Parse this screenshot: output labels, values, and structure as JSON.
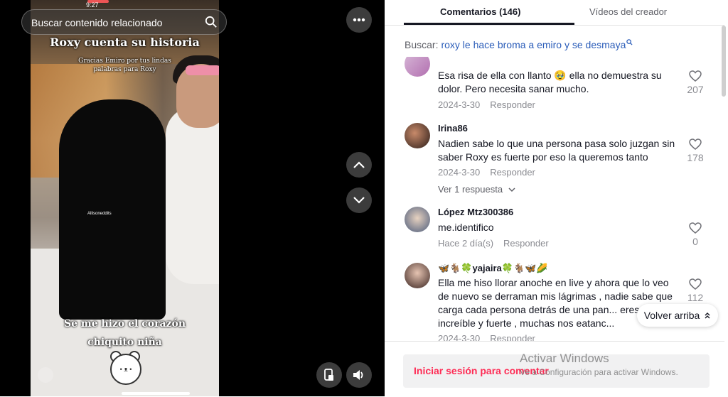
{
  "video": {
    "status_time": "9:27",
    "search_label": "Buscar contenido relacionado",
    "caption_title": "Roxy cuenta su historia",
    "caption_sub": "Gracias Emiro por tus lindas palabras para Roxy",
    "caption_bottom": "Se me hizo el corazón chiquito niña",
    "watermark": "Allisoneddits"
  },
  "tabs": {
    "comments": "Comentarios (146)",
    "creator_videos": "Vídeos del creador"
  },
  "search": {
    "prefix": "Buscar:",
    "query": "roxy le hace broma a emiro y se desmaya"
  },
  "comments": [
    {
      "name": "",
      "text": "Esa risa de ella con llanto 🥹 ella no demuestra su dolor. Pero necesita sanar mucho.",
      "date": "2024-3-30",
      "reply": "Responder",
      "likes": "207"
    },
    {
      "name": "Irina86",
      "text": "Nadien sabe lo que una persona pasa solo juzgan sin saber Roxy es fuerte por eso la queremos tanto",
      "date": "2024-3-30",
      "reply": "Responder",
      "likes": "178",
      "view_replies": "Ver 1 respuesta"
    },
    {
      "name": "López Mtz300386",
      "text": "me.identifico",
      "date": "Hace 2 día(s)",
      "reply": "Responder",
      "likes": "0"
    },
    {
      "name": "🦋🐐🍀yajaira🍀🐐🦋🌽",
      "text": "Ella me hiso llorar anoche en live y ahora que lo veo de nuevo se derraman mis lágrimas , nadie sabe que carga cada persona detrás de una pan... eres increíble y fuerte , muchas nos eatanc...",
      "date": "2024-3-30",
      "reply": "Responder",
      "likes": "112"
    }
  ],
  "back_to_top": "Volver arriba",
  "login_prompt": "Iniciar sesión para comentar",
  "windows": {
    "title": "Activar Windows",
    "subtitle": "Ve a Configuración para activar Windows."
  },
  "colors": {
    "accent": "#fe2c55",
    "link": "#2b5db9"
  }
}
